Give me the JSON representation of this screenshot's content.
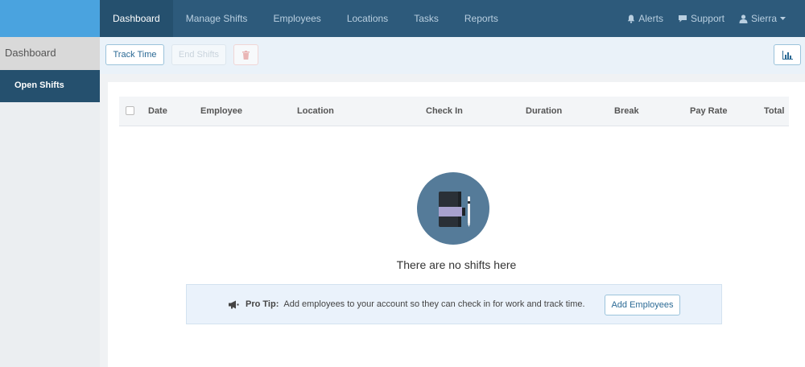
{
  "nav": {
    "items": [
      {
        "label": "Dashboard",
        "active": true
      },
      {
        "label": "Manage Shifts"
      },
      {
        "label": "Employees"
      },
      {
        "label": "Locations"
      },
      {
        "label": "Tasks"
      },
      {
        "label": "Reports"
      }
    ],
    "right": {
      "alerts": "Alerts",
      "support": "Support",
      "user": "Sierra"
    }
  },
  "sidebar": {
    "title": "Dashboard",
    "items": [
      {
        "label": "Open Shifts",
        "active": true
      }
    ]
  },
  "toolbar": {
    "track_time": "Track Time",
    "end_shifts": "End Shifts"
  },
  "table": {
    "headers": [
      "Date",
      "Employee",
      "Location",
      "Check In",
      "Duration",
      "Break",
      "Pay Rate",
      "Total"
    ]
  },
  "empty": {
    "message": "There are no shifts here"
  },
  "tip": {
    "label": "Pro Tip:",
    "text": "Add employees to your account so they can check in for work and track time.",
    "button": "Add Employees"
  },
  "colors": {
    "nav_bg": "#2d5a7b",
    "brand_bg": "#4aa3df",
    "active_bg": "#25506e",
    "accent": "#2b6a95",
    "empty_icon_bg": "#557b99"
  }
}
